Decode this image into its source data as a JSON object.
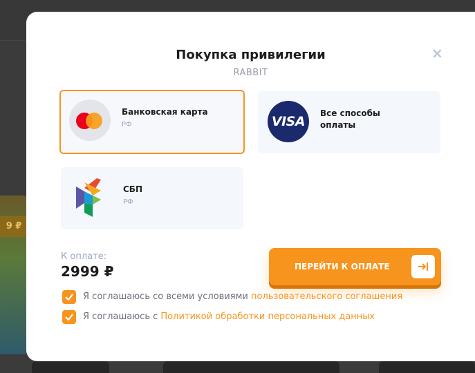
{
  "background": {
    "card_tag": "9 ₽"
  },
  "modal": {
    "title": "Покупка привилегии",
    "subtitle": "RABBIT",
    "close_icon": "close-icon"
  },
  "methods": [
    {
      "name": "Банковская карта",
      "sub": "РФ",
      "icon": "mastercard-icon",
      "selected": true
    },
    {
      "name_line1": "Все способы",
      "name_line2": "оплаты",
      "icon": "visa-icon",
      "logo_text": "VISA"
    },
    {
      "name": "СБП",
      "sub": "РФ",
      "icon": "sbp-icon"
    }
  ],
  "payment": {
    "label": "К оплате:",
    "amount": "2999 ₽",
    "button_label": "ПЕРЕЙТИ К ОПЛАТЕ",
    "button_icon": "arrow-right-to-bracket-icon"
  },
  "agreements": [
    {
      "text": "Я соглашаюсь со всеми условиями ",
      "link": "пользовательского соглашения",
      "checked": true
    },
    {
      "text": "Я соглашаюсь с ",
      "link": "Политикой обработки персональных данных",
      "checked": true
    }
  ],
  "colors": {
    "accent": "#f7941d",
    "link": "#f7941d",
    "visa_blue": "#1a2a6c",
    "muted": "#9aa6c2"
  }
}
